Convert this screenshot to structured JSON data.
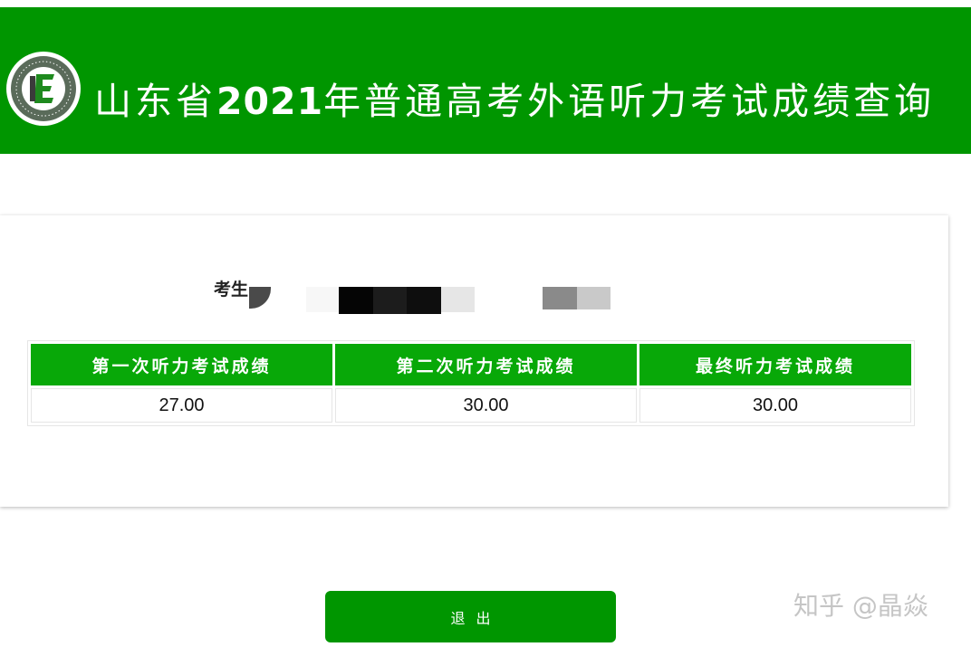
{
  "header": {
    "title_prefix": "山东省",
    "title_year": "2021",
    "title_suffix": "年普通高考外语听力考试成绩查询"
  },
  "candidate": {
    "label": "考生"
  },
  "score_table": {
    "headers": [
      "第一次听力考试成绩",
      "第二次听力考试成绩",
      "最终听力考试成绩"
    ],
    "values": [
      "27.00",
      "30.00",
      "30.00"
    ]
  },
  "actions": {
    "exit_label": "退出"
  },
  "watermark": {
    "text": "知乎 @晶焱"
  },
  "colors": {
    "header_green": "#009600",
    "table_header_green": "#08a808",
    "button_green": "#009600"
  }
}
